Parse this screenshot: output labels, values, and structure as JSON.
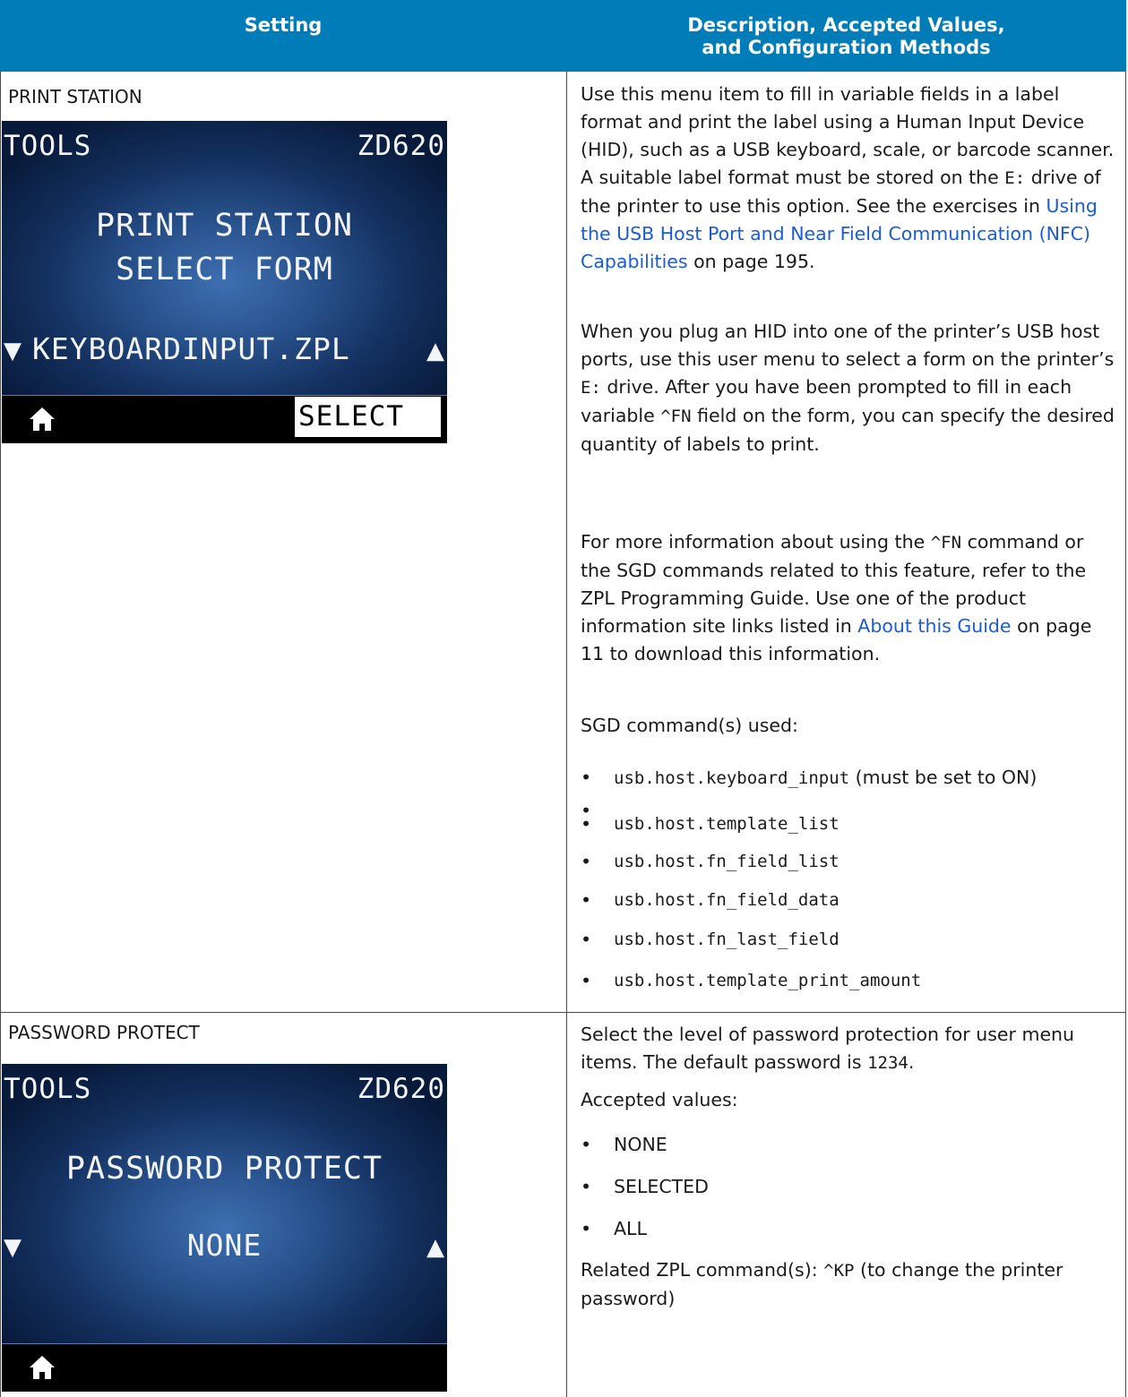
{
  "table": {
    "headers": {
      "setting": "Setting",
      "description_line1": "Description, Accepted Values,",
      "description_line2": "and Configuration Methods"
    }
  },
  "print_station": {
    "title": "PRINT STATION",
    "screen": {
      "menu": "TOOLS",
      "model": "ZD620",
      "line1": "PRINT STATION",
      "line2": "SELECT FORM",
      "value": "KEYBOARDINPUT.ZPL",
      "softkey": "SELECT"
    },
    "para1": {
      "t1": "Use this menu item to fill in variable fields in a label format and print the label using a Human Input Device (HID), such as a USB keyboard, scale, or barcode scanner. A suitable label format must be stored on the ",
      "code": "E:",
      "t2": " drive of the printer to use this option. See the exercises in ",
      "link": "Using the USB Host Port and Near Field Communication (NFC) Capabilities",
      "t3": " on page 195."
    },
    "para2": {
      "t1": "When you plug an HID into one of the printer’s USB host ports, use this user menu to select a form on the printer’s ",
      "code1": "E:",
      "t2": " drive. After you have been prompted to fill in each variable ",
      "code2": "^FN",
      "t3": " field on the form, you can specify the desired quantity of labels to print."
    },
    "para3": {
      "t1": "For more information about using the ",
      "code": "^FN",
      "t2": " command or the SGD commands related to this feature, refer to the ZPL Programming Guide. Use one of the product information site links listed in ",
      "link": "About this Guide",
      "t3": " on page 11 to download this information."
    },
    "sgd_label": "SGD command(s) used:",
    "sgd": [
      {
        "code": "usb.host.keyboard_input",
        "note": " (must be set to ON)"
      },
      {
        "code": "usb.host.template_list"
      },
      {
        "code": "usb.host.fn_field_list"
      },
      {
        "code": "usb.host.fn_field_data"
      },
      {
        "code": "usb.host.fn_last_field"
      },
      {
        "code": "usb.host.template_print_amount"
      }
    ]
  },
  "password_protect": {
    "title": "PASSWORD PROTECT",
    "screen": {
      "menu": "TOOLS",
      "model": "ZD620",
      "line1": "PASSWORD PROTECT",
      "value": "NONE"
    },
    "para1": {
      "t1": "Select the level of password protection for user menu items. The default password is ",
      "code": "1234",
      "t2": "."
    },
    "accepted_label": "Accepted values:",
    "values": [
      "NONE",
      "SELECTED",
      "ALL"
    ],
    "related": {
      "t1": "Related ZPL command(s): ",
      "code": "^KP",
      "t2": " (to change the printer password)"
    }
  },
  "colors": {
    "header_bg": "#007db8",
    "link": "#1a5bd9",
    "lcd_bg": "#1a3a6e"
  },
  "icons": [
    "home-icon",
    "down-arrow-icon",
    "up-arrow-icon"
  ]
}
